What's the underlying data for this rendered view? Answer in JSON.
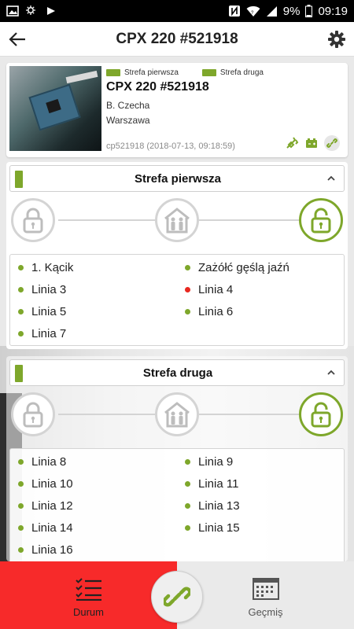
{
  "status_bar": {
    "battery": "9%",
    "time": "09:19",
    "icons": [
      "image-icon",
      "weather-icon",
      "download-icon",
      "nfc-icon",
      "wifi-icon",
      "signal-icon",
      "battery-icon"
    ]
  },
  "app_bar": {
    "title": "CPX 220 #521918",
    "back_icon": "arrow-left-icon",
    "settings_icon": "gear-icon"
  },
  "device": {
    "zone_tags": [
      "Strefa pierwsza",
      "Strefa druga"
    ],
    "title": "CPX 220 #521918",
    "owner": "B. Czecha",
    "city": "Warszawa",
    "meta": "cp521918 (2018-07-13, 09:18:59)",
    "icons": [
      "plug-icon",
      "battery-icon",
      "link-icon"
    ]
  },
  "zones": [
    {
      "name": "Strefa pierwsza",
      "state_icons": [
        "lock-closed-icon",
        "home-family-icon",
        "lock-open-icon"
      ],
      "active_state": "lock-open-icon",
      "lines": [
        {
          "label": "1. Kącik",
          "status": "ok"
        },
        {
          "label": "Zażółć gęślą jaźń",
          "status": "ok"
        },
        {
          "label": "Linia 3",
          "status": "ok"
        },
        {
          "label": "Linia 4",
          "status": "alarm"
        },
        {
          "label": "Linia 5",
          "status": "ok"
        },
        {
          "label": "Linia 6",
          "status": "ok"
        },
        {
          "label": "Linia 7",
          "status": "ok"
        }
      ]
    },
    {
      "name": "Strefa druga",
      "state_icons": [
        "lock-closed-icon",
        "home-family-icon",
        "lock-open-icon"
      ],
      "active_state": "lock-open-icon",
      "lines": [
        {
          "label": "Linia 8",
          "status": "ok"
        },
        {
          "label": "Linia 9",
          "status": "ok"
        },
        {
          "label": "Linia 10",
          "status": "ok"
        },
        {
          "label": "Linia 11",
          "status": "ok"
        },
        {
          "label": "Linia 12",
          "status": "ok"
        },
        {
          "label": "Linia 13",
          "status": "ok"
        },
        {
          "label": "Linia 14",
          "status": "ok"
        },
        {
          "label": "Linia 15",
          "status": "ok"
        },
        {
          "label": "Linia 16",
          "status": "ok"
        }
      ]
    }
  ],
  "bottom_nav": {
    "tabs": [
      {
        "label": "Durum",
        "icon": "checklist-icon",
        "active": true
      },
      {
        "label": "Geçmiş",
        "icon": "calendar-icon",
        "active": false
      }
    ],
    "fab_icon": "link-icon"
  },
  "colors": {
    "accent": "#7ea72b",
    "alarm": "#e8281f",
    "active_tab": "#f72a2a"
  }
}
